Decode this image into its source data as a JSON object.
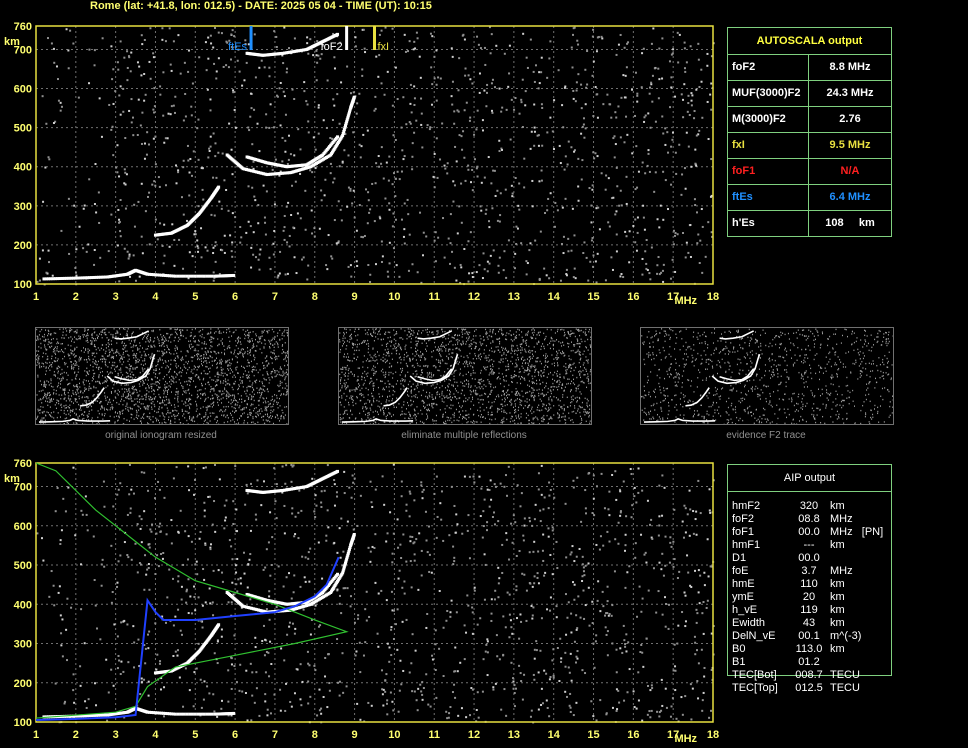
{
  "header": {
    "title": "Rome (lat: +41.8, lon: 012.5) - DATE: 2025 05 04 - TIME (UT): 10:15"
  },
  "axes": {
    "y_unit": "km",
    "x_unit": "MHz",
    "y_ticks": [
      "100",
      "200",
      "300",
      "400",
      "500",
      "600",
      "700",
      "760"
    ],
    "x_ticks": [
      "1",
      "2",
      "3",
      "4",
      "5",
      "6",
      "7",
      "8",
      "9",
      "10",
      "11",
      "12",
      "13",
      "14",
      "15",
      "16",
      "17",
      "18"
    ]
  },
  "markers": {
    "ftEs": "ftEs",
    "foF2": "foF2",
    "fxI": "fxI"
  },
  "autoscala": {
    "title": "AUTOSCALA output",
    "rows": [
      {
        "key": "foF2",
        "value": "8.8 MHz",
        "color": "#ffffff"
      },
      {
        "key": "MUF(3000)F2",
        "value": "24.3 MHz",
        "color": "#ffffff"
      },
      {
        "key": "M(3000)F2",
        "value": "2.76",
        "color": "#ffffff"
      },
      {
        "key": "fxI",
        "value": "9.5 MHz",
        "color": "#e8e040"
      },
      {
        "key": "foF1",
        "value": "N/A",
        "color": "#ff2020"
      },
      {
        "key": "ftEs",
        "value": "6.4 MHz",
        "color": "#2090ff"
      },
      {
        "key": "h'Es",
        "value": "108     km",
        "color": "#ffffff"
      }
    ]
  },
  "thumbnails": {
    "cap1": "original ionogram resized",
    "cap2": "eliminate multiple reflections",
    "cap3": "evidence F2 trace"
  },
  "aip": {
    "title": "AIP output",
    "rows": [
      {
        "key": "hmF2",
        "value": "320",
        "unit": "km"
      },
      {
        "key": "foF2",
        "value": "08.8",
        "unit": "MHz"
      },
      {
        "key": "foF1",
        "value": "00.0",
        "unit": "MHz   [PN]"
      },
      {
        "key": "hmF1",
        "value": "---",
        "unit": "km"
      },
      {
        "key": "D1",
        "value": "00.0",
        "unit": ""
      },
      {
        "key": "foE",
        "value": "3.7",
        "unit": "MHz"
      },
      {
        "key": "hmE",
        "value": "110",
        "unit": "km"
      },
      {
        "key": "ymE",
        "value": "20",
        "unit": "km"
      },
      {
        "key": "h_vE",
        "value": "119",
        "unit": "km"
      },
      {
        "key": "Ewidth",
        "value": "43",
        "unit": "km"
      },
      {
        "key": "DelN_vE",
        "value": "00.1",
        "unit": "m^(-3)"
      },
      {
        "key": "B0",
        "value": "113.0",
        "unit": "km"
      },
      {
        "key": "B1",
        "value": "01.2",
        "unit": ""
      },
      {
        "key": "TEC[Bot]",
        "value": "008.7",
        "unit": "TECU"
      },
      {
        "key": "TEC[Top]",
        "value": "012.5",
        "unit": "TECU"
      }
    ]
  },
  "chart_data": [
    {
      "type": "scatter",
      "title": "",
      "xlabel": "MHz",
      "ylabel": "km",
      "xlim": [
        1,
        18
      ],
      "ylim": [
        100,
        760
      ],
      "grid": true,
      "series": [
        {
          "name": "",
          "x": [
            1.2,
            2.0,
            2.8,
            3.3,
            3.5,
            3.8,
            4.5,
            5.5,
            6.0
          ],
          "y": [
            113,
            115,
            118,
            125,
            135,
            125,
            120,
            120,
            122
          ]
        },
        {
          "name": "",
          "x": [
            4.0,
            4.4,
            4.8,
            5.1,
            5.4,
            5.6
          ],
          "y": [
            225,
            230,
            250,
            280,
            320,
            350
          ]
        },
        {
          "name": "",
          "x": [
            5.8,
            6.2,
            6.8,
            7.4,
            7.9,
            8.4,
            8.7,
            8.9,
            9.0
          ],
          "y": [
            430,
            395,
            380,
            385,
            400,
            430,
            480,
            550,
            580
          ]
        },
        {
          "name": "",
          "x": [
            6.3,
            6.8,
            7.3,
            7.8,
            8.2,
            8.6
          ],
          "y": [
            425,
            410,
            400,
            405,
            430,
            480
          ]
        },
        {
          "name": "",
          "x": [
            6.3,
            6.7,
            7.2,
            7.8,
            8.2,
            8.6
          ],
          "y": [
            690,
            685,
            690,
            700,
            720,
            740
          ]
        }
      ]
    },
    {
      "type": "line",
      "title": "",
      "xlabel": "MHz",
      "ylabel": "km",
      "xlim": [
        1,
        18
      ],
      "ylim": [
        100,
        760
      ],
      "grid": true,
      "series": [
        {
          "name": "",
          "color": "#30c030",
          "x": [
            1.0,
            1.5,
            2.5,
            3.5,
            4.0,
            5.0,
            6.0,
            7.0,
            8.0,
            8.8,
            7.5,
            6.0,
            4.5,
            3.8,
            3.5,
            3.0,
            1.0
          ],
          "y": [
            760,
            740,
            640,
            560,
            520,
            460,
            430,
            400,
            360,
            330,
            300,
            270,
            240,
            190,
            140,
            125,
            110
          ]
        },
        {
          "name": "",
          "color": "#2040ff",
          "x": [
            1.0,
            2.0,
            3.0,
            3.5,
            3.8,
            4.0,
            4.2,
            5.0,
            6.0,
            7.0,
            7.5,
            8.0,
            8.3,
            8.6
          ],
          "y": [
            105,
            108,
            112,
            118,
            410,
            380,
            360,
            360,
            370,
            380,
            395,
            420,
            450,
            520
          ]
        }
      ]
    }
  ]
}
